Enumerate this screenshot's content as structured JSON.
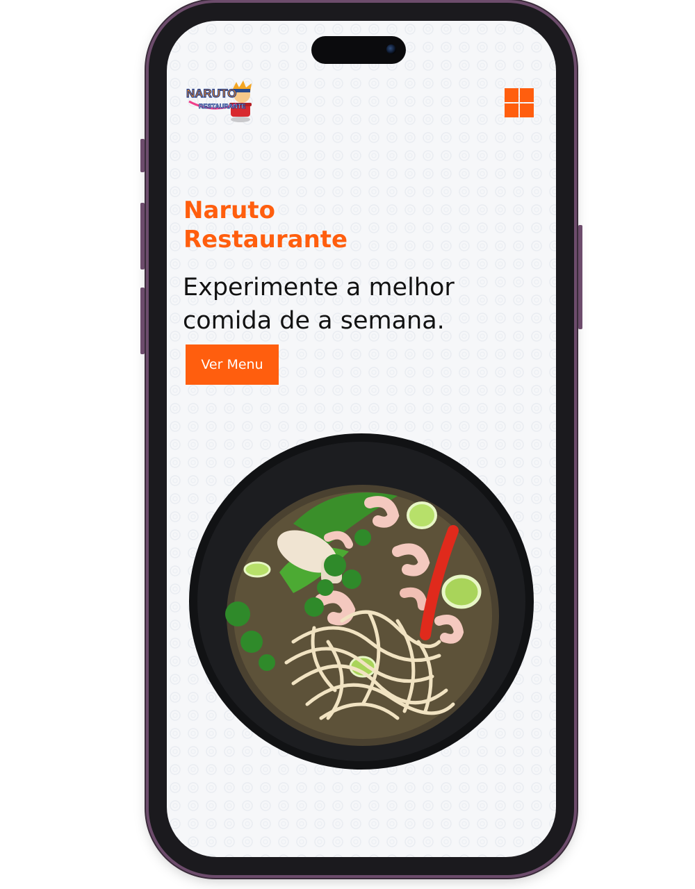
{
  "logo": {
    "line1": "NARUTO",
    "line2": "RESTAURANTE"
  },
  "header": {
    "menu_icon": "grid-menu-icon"
  },
  "hero": {
    "brand_line1": "Naruto",
    "brand_line2": "Restaurante",
    "tagline_line1": "Experimente a melhor",
    "tagline_line2": "comida de a semana.",
    "cta_label": "Ver Menu"
  },
  "colors": {
    "accent": "#ff5e0e",
    "text": "#121212",
    "background": "#f6f7f9",
    "phone_frame": "#6d4c6c"
  }
}
